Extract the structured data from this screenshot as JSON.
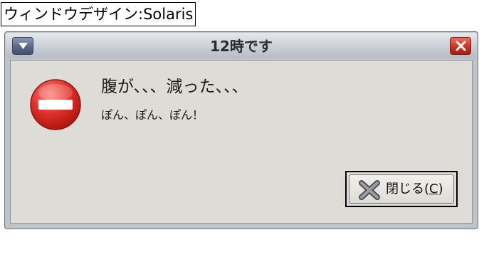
{
  "caption": "ウィンドウデザイン:Solaris",
  "window": {
    "title": "12時です",
    "menu_icon": "chevron-down-icon",
    "close_icon": "close-icon"
  },
  "dialog": {
    "icon": "stop-icon",
    "message": "腹が、、、減った、、、",
    "detail": "ぽん、ぽん、ぽん！",
    "button": {
      "label_prefix": "閉じる(",
      "mnemonic": "C",
      "label_suffix": ")",
      "icon": "x-icon"
    }
  },
  "colors": {
    "titlebar": "#c9cdd4",
    "client_bg": "#dedcd6",
    "close_red": "#c93524",
    "stop_red": "#e0302a"
  }
}
